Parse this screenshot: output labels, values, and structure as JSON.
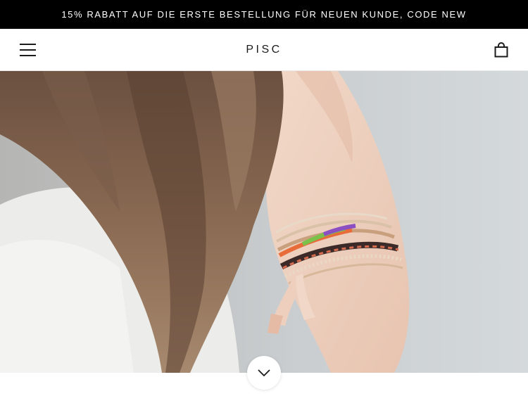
{
  "announcement": {
    "text": "15% RABATT AUF DIE ERSTE BESTELLUNG FÜR NEUEN KUNDE, CODE NEW"
  },
  "header": {
    "logo": "PISC",
    "menu_icon": "hamburger-menu-icon",
    "cart_icon": "shopping-bag-icon"
  },
  "hero": {
    "image_subject": "woman-arm-with-stacked-bracelets",
    "scroll_icon": "chevron-down-icon"
  },
  "colors": {
    "announcement_bg": "#000000",
    "announcement_text": "#ffffff",
    "header_bg": "#ffffff",
    "text_dark": "#1c1b1b"
  }
}
